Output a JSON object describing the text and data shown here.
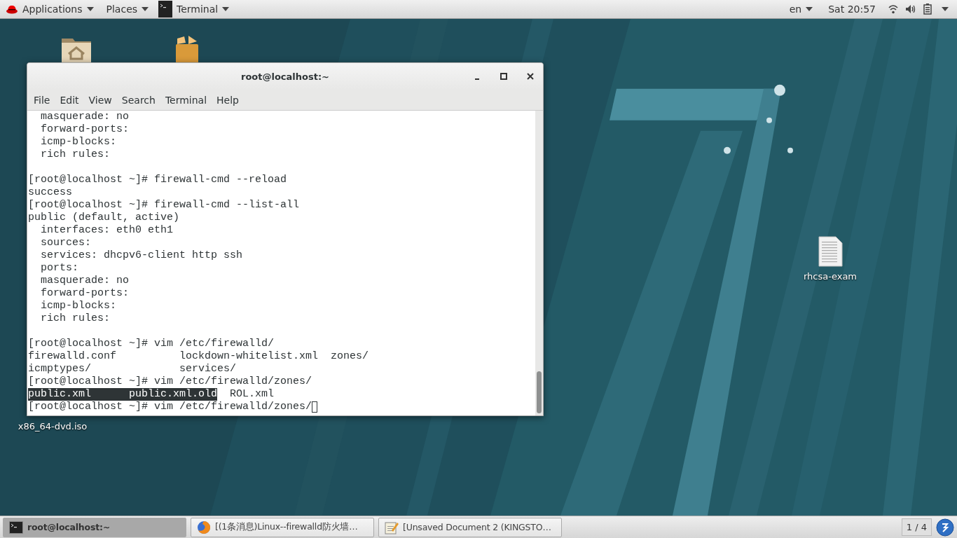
{
  "top_bar": {
    "menus": [
      {
        "label": "Applications",
        "kind": "logo"
      },
      {
        "label": "Places",
        "kind": "plain"
      },
      {
        "label": "Terminal",
        "kind": "app"
      }
    ],
    "keyboard_layout": "en",
    "clock": "Sat 20:57"
  },
  "desktop_icons": [
    {
      "kind": "home-folder"
    },
    {
      "kind": "package"
    },
    {
      "kind": "document",
      "label": "rhcsa-exam"
    },
    {
      "kind": "label-only",
      "label": "x86_64-dvd.iso"
    }
  ],
  "terminal_window": {
    "title": "root@localhost:~",
    "menu": [
      "File",
      "Edit",
      "View",
      "Search",
      "Terminal",
      "Help"
    ],
    "lines": [
      {
        "kind": "text",
        "segments": [
          {
            "text": "  masquerade: no",
            "selected": false
          }
        ]
      },
      {
        "kind": "text",
        "segments": [
          {
            "text": "  forward-ports:",
            "selected": false
          }
        ]
      },
      {
        "kind": "text",
        "segments": [
          {
            "text": "  icmp-blocks:",
            "selected": false
          }
        ]
      },
      {
        "kind": "text",
        "segments": [
          {
            "text": "  rich rules:",
            "selected": false
          }
        ]
      },
      {
        "kind": "blank"
      },
      {
        "kind": "text",
        "segments": [
          {
            "text": "[root@localhost ~]# firewall-cmd --reload",
            "selected": false
          }
        ]
      },
      {
        "kind": "text",
        "segments": [
          {
            "text": "success",
            "selected": false
          }
        ]
      },
      {
        "kind": "text",
        "segments": [
          {
            "text": "[root@localhost ~]# firewall-cmd --list-all",
            "selected": false
          }
        ]
      },
      {
        "kind": "text",
        "segments": [
          {
            "text": "public (default, active)",
            "selected": false
          }
        ]
      },
      {
        "kind": "text",
        "segments": [
          {
            "text": "  interfaces: eth0 eth1",
            "selected": false
          }
        ]
      },
      {
        "kind": "text",
        "segments": [
          {
            "text": "  sources:",
            "selected": false
          }
        ]
      },
      {
        "kind": "text",
        "segments": [
          {
            "text": "  services: dhcpv6-client http ssh",
            "selected": false
          }
        ]
      },
      {
        "kind": "text",
        "segments": [
          {
            "text": "  ports:",
            "selected": false
          }
        ]
      },
      {
        "kind": "text",
        "segments": [
          {
            "text": "  masquerade: no",
            "selected": false
          }
        ]
      },
      {
        "kind": "text",
        "segments": [
          {
            "text": "  forward-ports:",
            "selected": false
          }
        ]
      },
      {
        "kind": "text",
        "segments": [
          {
            "text": "  icmp-blocks:",
            "selected": false
          }
        ]
      },
      {
        "kind": "text",
        "segments": [
          {
            "text": "  rich rules:",
            "selected": false
          }
        ]
      },
      {
        "kind": "blank"
      },
      {
        "kind": "text",
        "segments": [
          {
            "text": "[root@localhost ~]# vim /etc/firewalld/",
            "selected": false
          }
        ]
      },
      {
        "kind": "text",
        "segments": [
          {
            "text": "firewalld.conf          lockdown-whitelist.xml  zones/",
            "selected": false
          }
        ]
      },
      {
        "kind": "text",
        "segments": [
          {
            "text": "icmptypes/              services/",
            "selected": false
          }
        ]
      },
      {
        "kind": "text",
        "segments": [
          {
            "text": "[root@localhost ~]# vim /etc/firewalld/zones/",
            "selected": false
          }
        ]
      },
      {
        "kind": "text",
        "segments": [
          {
            "text": "public.xml      public.xml.old",
            "selected": true
          },
          {
            "text": "  ROL.xml",
            "selected": false
          }
        ]
      },
      {
        "kind": "prompt",
        "cursor": true,
        "segments": [
          {
            "text": "[root@localhost ~]# vim /etc/firewalld/zones/",
            "selected": false
          }
        ]
      }
    ]
  },
  "taskbar": {
    "items": [
      {
        "label": "root@localhost:~",
        "kind": "terminal",
        "selected": true
      },
      {
        "label": "[(1条消息)Linux--firewalld防火墙…",
        "kind": "browser",
        "selected": false
      },
      {
        "label": "[Unsaved Document 2 (KINGSTO…",
        "kind": "editor",
        "selected": false
      }
    ],
    "workspace": "1 / 4"
  }
}
